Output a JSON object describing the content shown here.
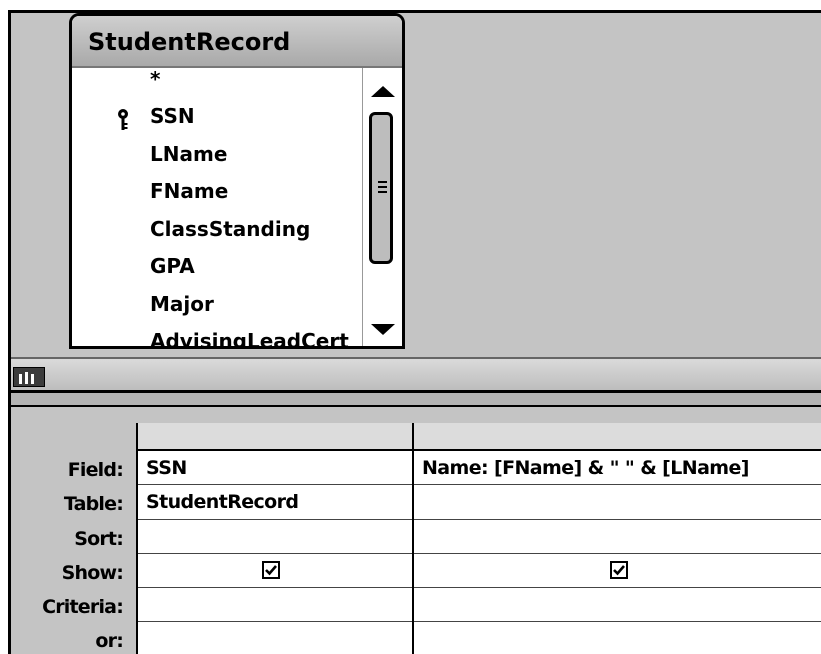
{
  "table": {
    "title": "StudentRecord",
    "fields": [
      "*",
      "SSN",
      "LName",
      "FName",
      "ClassStanding",
      "GPA",
      "Major",
      "AdvisingLeadCert"
    ],
    "primary_key": "SSN"
  },
  "grid": {
    "row_labels": {
      "field": "Field:",
      "table": "Table:",
      "sort": "Sort:",
      "show": "Show:",
      "criteria": "Criteria:",
      "or": "or:"
    },
    "columns": [
      {
        "field": "SSN",
        "table": "StudentRecord",
        "sort": "",
        "show": true,
        "criteria": "",
        "or": ""
      },
      {
        "field": "Name: [FName] & \" \" & [LName]",
        "table": "",
        "sort": "",
        "show": true,
        "criteria": "",
        "or": ""
      }
    ]
  },
  "icons": {
    "primary_key": "key-icon",
    "scroll_up": "arrow-up-icon",
    "scroll_down": "arrow-down-icon",
    "splitter": "splitter-icon",
    "checkbox": "checkmark-icon"
  }
}
